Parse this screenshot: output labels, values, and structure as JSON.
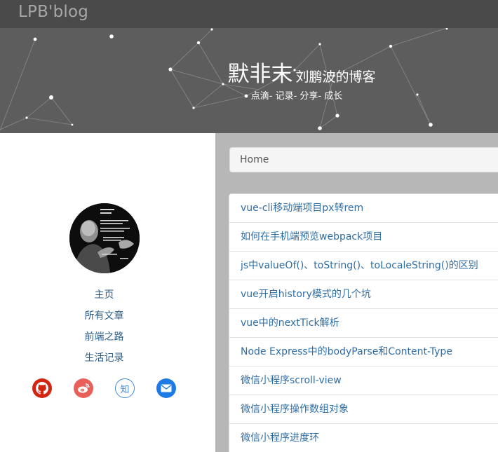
{
  "navbar": {
    "brand": "LPB'blog"
  },
  "banner": {
    "title_main": "默非末",
    "title_sub": "刘鹏波的博客",
    "tagline": "点滴- 记录- 分享- 成长"
  },
  "sidebar": {
    "avatar_alt": "avatar",
    "links": [
      {
        "label": "主页"
      },
      {
        "label": "所有文章"
      },
      {
        "label": "前端之路"
      },
      {
        "label": "生活记录"
      }
    ],
    "social": [
      {
        "name": "github-icon",
        "color": "#d32412"
      },
      {
        "name": "weibo-icon",
        "color": "#e9605a"
      },
      {
        "name": "zhihu-icon",
        "label": "知",
        "color": "#3f8ad6"
      },
      {
        "name": "mail-icon",
        "color": "#1e7be6"
      }
    ]
  },
  "breadcrumb": {
    "current": "Home"
  },
  "posts": [
    {
      "title": "vue-cli移动端项目px转rem"
    },
    {
      "title": "如何在手机端预览webpack项目"
    },
    {
      "title": "js中valueOf()、toString()、toLocaleString()的区别"
    },
    {
      "title": "vue开启history模式的几个坑"
    },
    {
      "title": "vue中的nextTick解析"
    },
    {
      "title": "Node Express中的bodyParse和Content-Type"
    },
    {
      "title": "微信小程序scroll-view"
    },
    {
      "title": "微信小程序操作数组对象"
    },
    {
      "title": "微信小程序进度环"
    }
  ],
  "colors": {
    "navbar_bg": "#4a4a4a",
    "banner_bg": "#5d5d5d",
    "link": "#2f6ea5",
    "page_bg": "#b7b7b7"
  }
}
